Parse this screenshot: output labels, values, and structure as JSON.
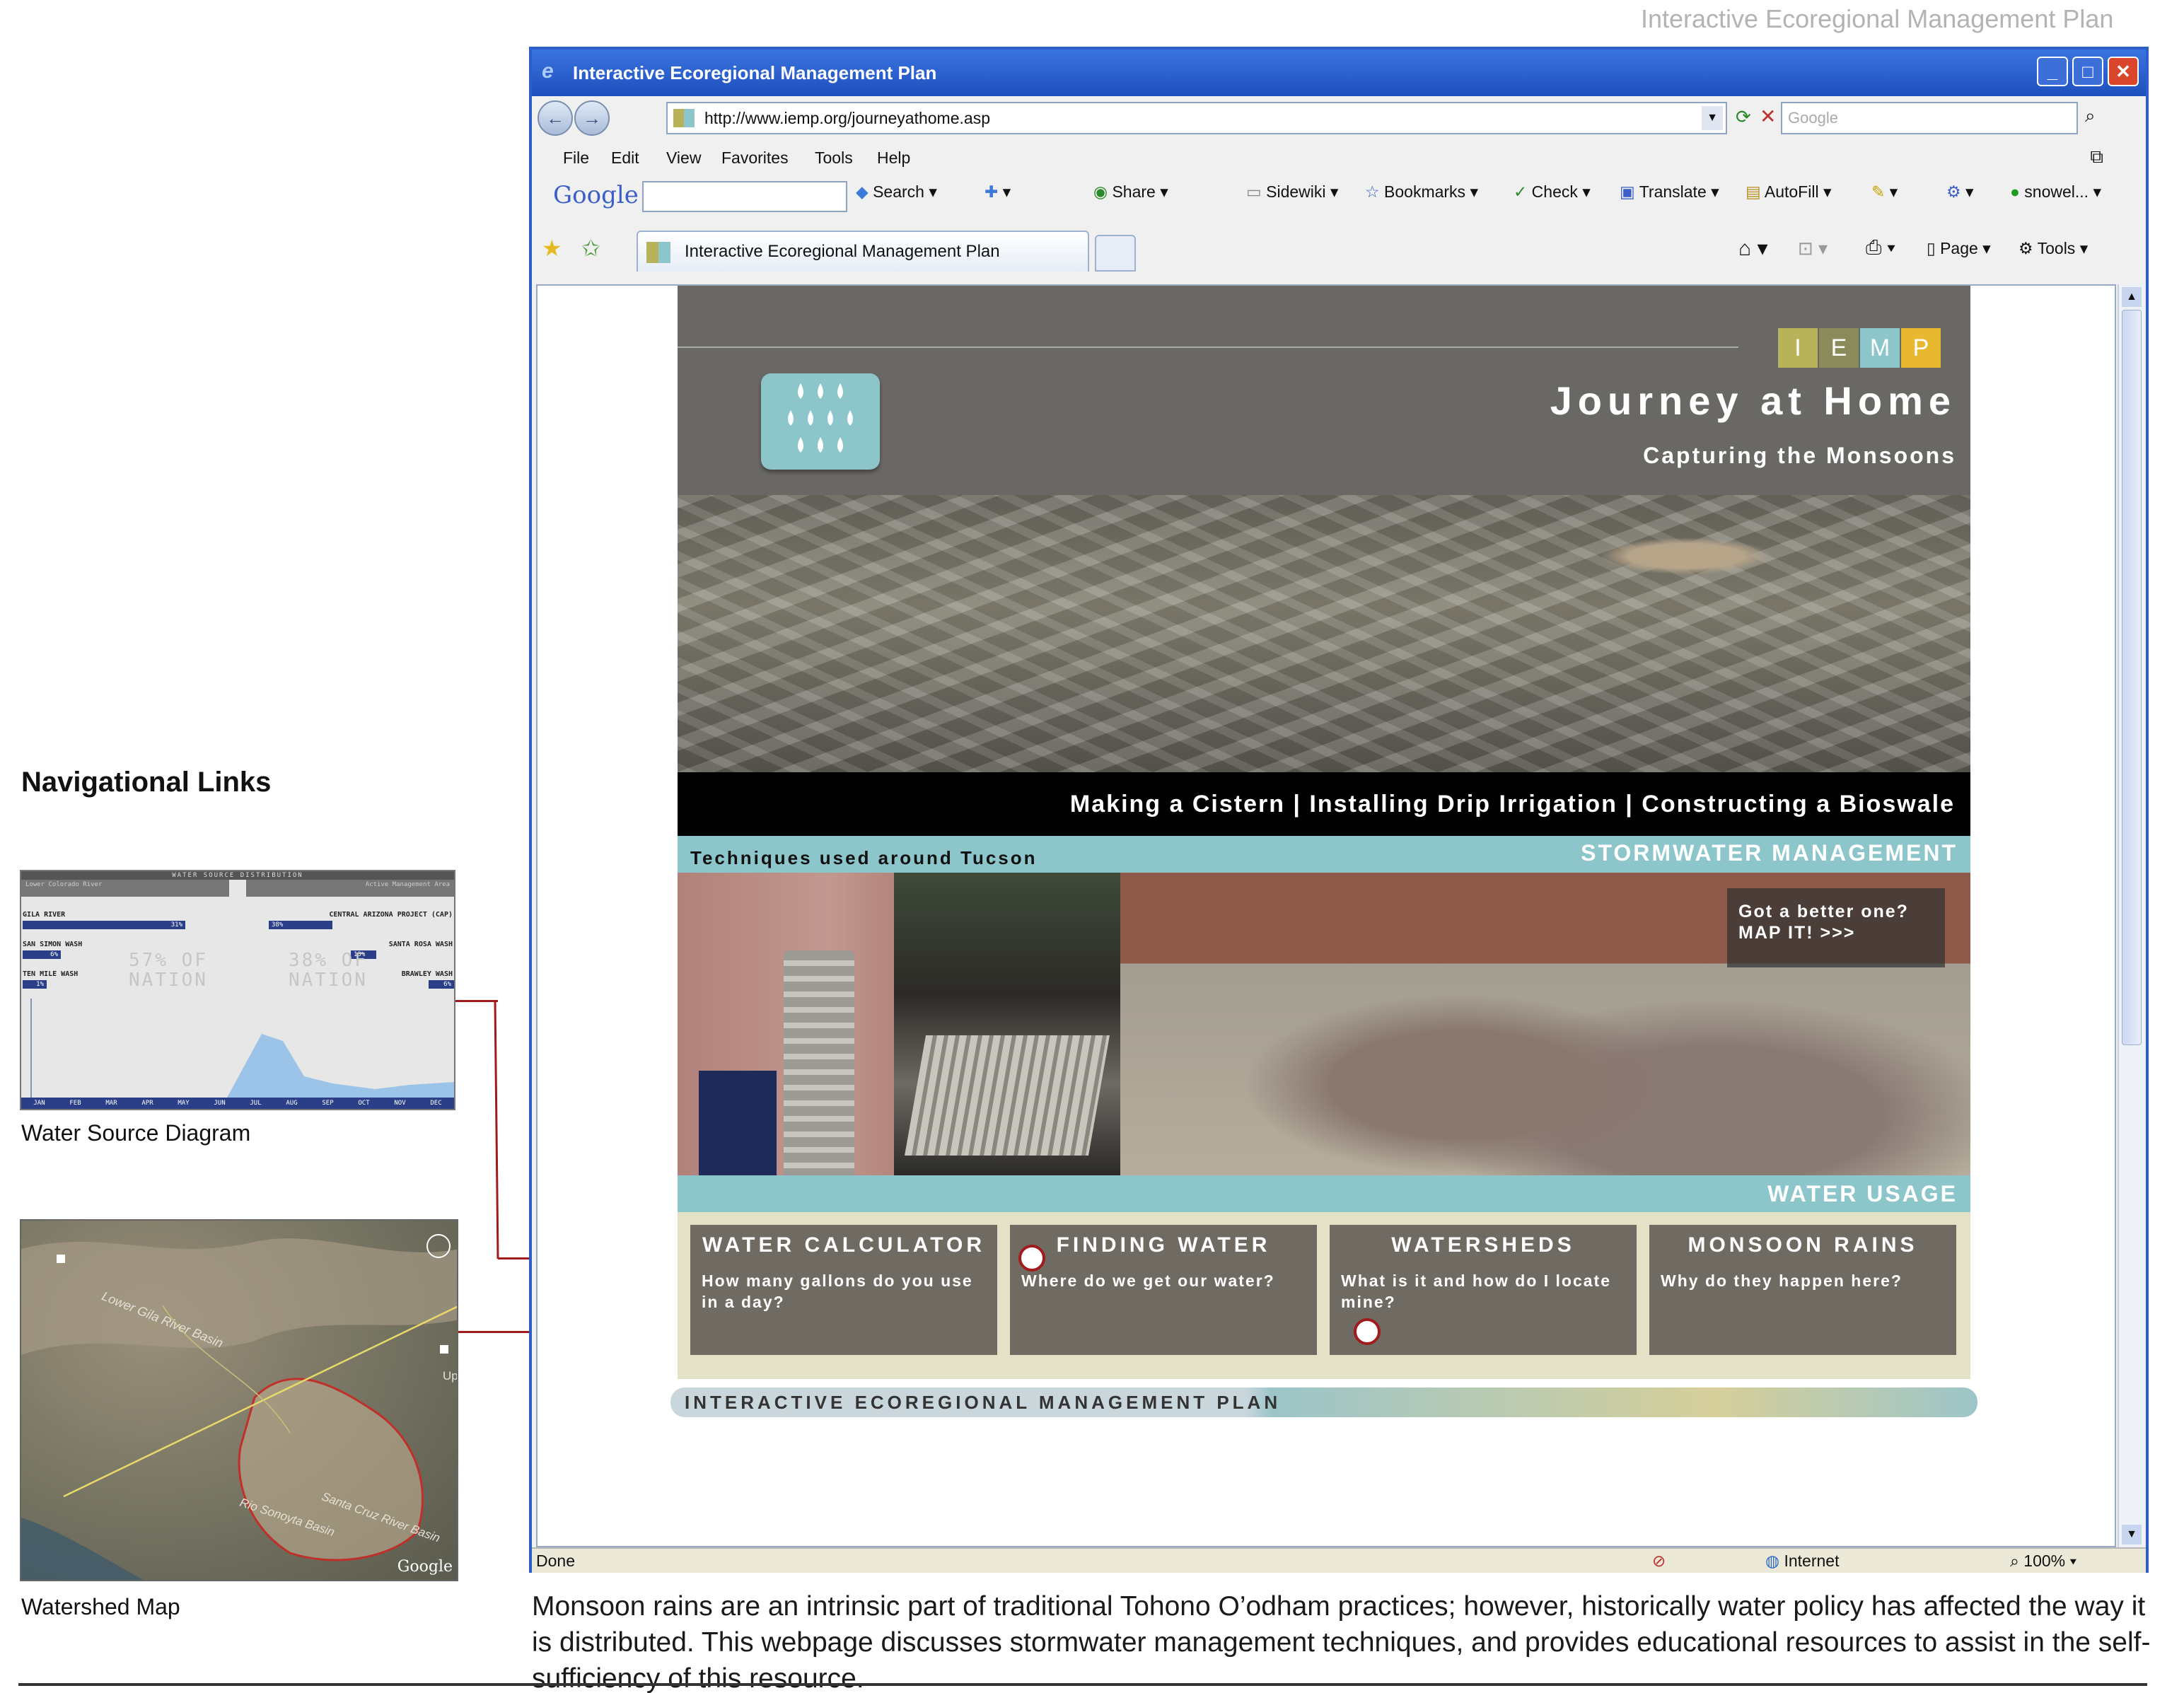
{
  "page_title": "Interactive Ecoregional Management Plan",
  "left_panel": {
    "heading": "Navigational Links",
    "water_diagram": {
      "caption": "Water Source Diagram",
      "header": "WATER SOURCE DISTRIBUTION",
      "left_region": "Lower Colorado River",
      "right_region": "Active Management Area",
      "left_rows": [
        {
          "label": "GILA RIVER",
          "value": "31%"
        },
        {
          "label": "SAN SIMON WASH",
          "value": "6%"
        },
        {
          "label": "TEN MILE WASH",
          "value": "1%"
        }
      ],
      "right_rows": [
        {
          "label": "CENTRAL ARIZONA PROJECT (CAP)",
          "value": "38%"
        },
        {
          "label": "SANTA ROSA WASH",
          "value": "13%"
        },
        {
          "label": "BRAWLEY WASH",
          "value": "6%"
        }
      ],
      "left_big": "57% OF NATION",
      "right_big": "38% OF NATION",
      "months": [
        "JAN",
        "FEB",
        "MAR",
        "APR",
        "MAY",
        "JUN",
        "JUL",
        "AUG",
        "SEP",
        "OCT",
        "NOV",
        "DEC"
      ]
    },
    "watershed_map": {
      "caption": "Watershed Map",
      "labels": [
        "Lower Gila River Basin",
        "Rio Sonoyta Basin",
        "Santa Cruz River Basin",
        "Up"
      ],
      "watermark": "Google"
    }
  },
  "browser": {
    "title": "Interactive Ecoregional Management Plan",
    "url": "http://www.iemp.org/journeyathome.asp",
    "search_placeholder": "Google",
    "menu": [
      "File",
      "Edit",
      "View",
      "Favorites",
      "Tools",
      "Help"
    ],
    "google_toolbar": {
      "logo": "Google",
      "items": [
        "Search",
        "Share",
        "Sidewiki",
        "Bookmarks",
        "Check",
        "Translate",
        "AutoFill",
        "snowel..."
      ]
    },
    "tab_label": "Interactive Ecoregional Management Plan",
    "command_bar": [
      "Page",
      "Tools"
    ],
    "status": {
      "left": "Done",
      "zone": "Internet",
      "zoom": "100%"
    }
  },
  "site": {
    "logo_letters": [
      "I",
      "E",
      "M",
      "P"
    ],
    "logo_colors": [
      "#b8b25a",
      "#8a8a5a",
      "#8cc6cb",
      "#e8b830"
    ],
    "title": "Journey at Home",
    "subtitle": "Capturing the Monsoons",
    "nav_links": "Making a Cistern | Installing Drip Irrigation | Constructing a Bioswale",
    "techniques_label": "Techniques used around Tucson",
    "stormwater_label": "STORMWATER MANAGEMENT",
    "cta_line1": "Got a better one?",
    "cta_line2": "MAP IT! >>>",
    "water_usage_label": "WATER USAGE",
    "cards": [
      {
        "title": "WATER CALCULATOR",
        "desc": "How many gallons do you use in a day?"
      },
      {
        "title": "FINDING WATER",
        "desc": "Where do we get our water?"
      },
      {
        "title": "WATERSHEDS",
        "desc": "What is it and how do I locate mine?"
      },
      {
        "title": "MONSOON RAINS",
        "desc": "Why do they happen here?"
      }
    ],
    "footer": "INTERACTIVE ECOREGIONAL MANAGEMENT PLAN"
  },
  "description": "Monsoon rains are an intrinsic part of traditional Tohono O’odham practices; however, historically water policy has affected the way it is distributed. This webpage discusses stormwater management techniques, and provides educational resources to assist in the self-sufficiency of this resource.",
  "accent_color": "#a01c1c"
}
